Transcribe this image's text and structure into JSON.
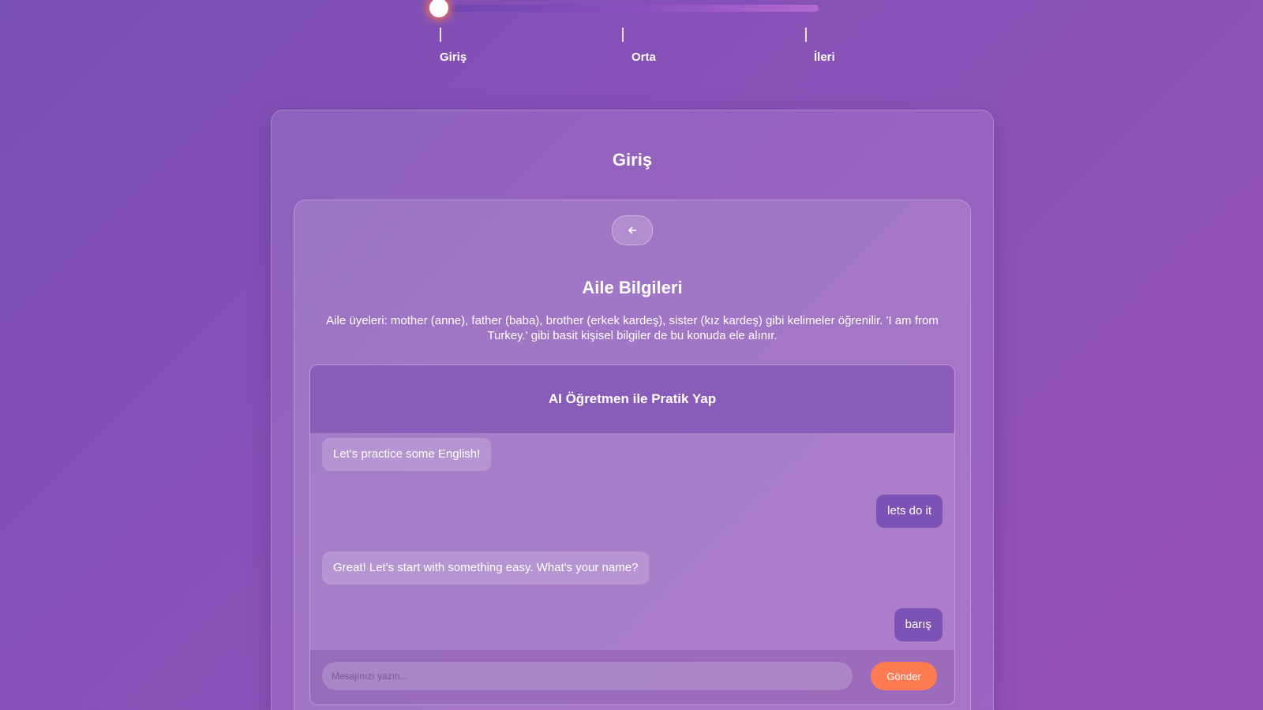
{
  "level_slider": {
    "value_fraction": 0.0,
    "levels": [
      "Giriş",
      "Orta",
      "İleri"
    ],
    "accent_color": "#ff7b54"
  },
  "section": {
    "title": "Giriş"
  },
  "topic": {
    "back_icon": "arrow-left-icon",
    "title": "Aile Bilgileri",
    "description": "Aile üyeleri: mother (anne), father (baba), brother (erkek kardeş), sister (kız kardeş) gibi kelimeler öğrenilir. 'I am from Turkey.' gibi basit kişisel bilgiler de bu konuda ele alınır."
  },
  "chat": {
    "title": "AI Öğretmen ile Pratik Yap",
    "messages": [
      {
        "sender": "ai",
        "text": "Let's practice some English!"
      },
      {
        "sender": "user",
        "text": "lets do it"
      },
      {
        "sender": "ai",
        "text": "Great! Let's start with something easy. What's your name?"
      },
      {
        "sender": "user",
        "text": "barış"
      }
    ],
    "input": {
      "placeholder": "Mesajınızı yazın...",
      "value": ""
    },
    "send_label": "Gönder",
    "send_color": "#ff7b54",
    "user_bubble_color": "#7c52b4"
  }
}
